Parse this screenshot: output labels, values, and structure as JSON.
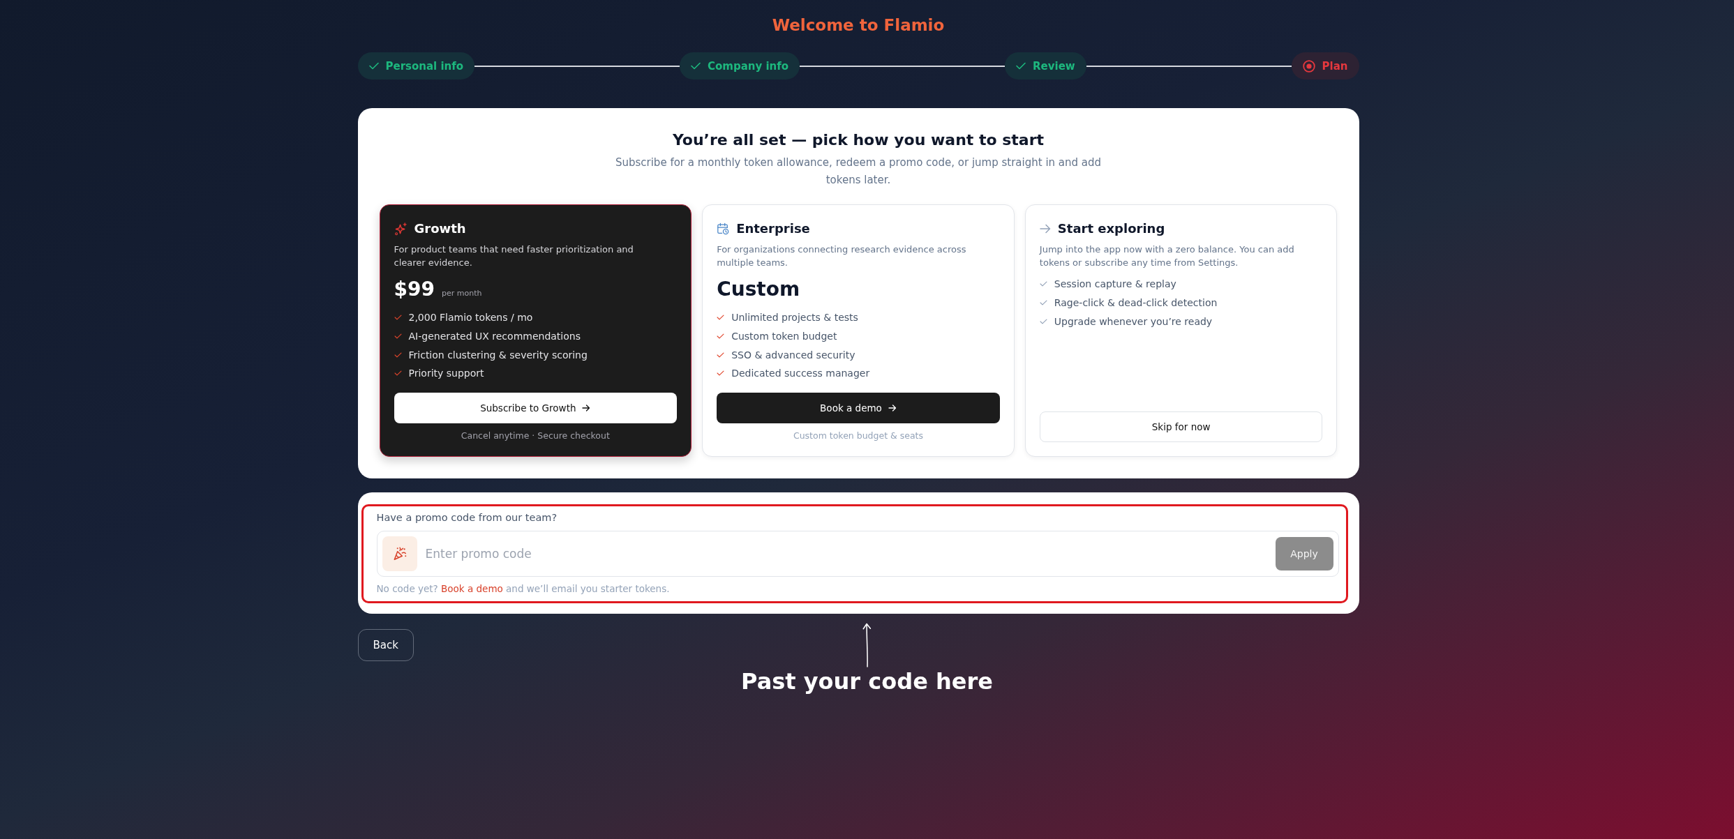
{
  "header": {
    "title": "Welcome to Flamio"
  },
  "steps": [
    {
      "label": "Personal info",
      "completed": true,
      "selected": false
    },
    {
      "label": "Company info",
      "completed": true,
      "selected": false
    },
    {
      "label": "Review",
      "completed": true,
      "selected": false
    },
    {
      "label": "Plan",
      "completed": false,
      "selected": true
    }
  ],
  "plan_picker": {
    "title": "You’re all set — pick how you want to start",
    "subtitle": "Subscribe for a monthly token allowance, redeem a promo code, or jump straight in and add tokens later.",
    "plans": [
      {
        "kind": "paid",
        "selected": true,
        "name": "Growth",
        "description": "For product teams that need faster prioritization and clearer evidence.",
        "price": "$99",
        "price_note": "per month",
        "features": [
          "2,000 Flamio tokens / mo",
          "AI-generated UX recommendations",
          "Friction clustering & severity scoring",
          "Priority support"
        ],
        "button": "Subscribe to Growth",
        "footnote": "Cancel anytime · Secure checkout"
      },
      {
        "kind": "custom",
        "selected": false,
        "name": "Enterprise",
        "description": "For organizations connecting research evidence across multiple teams.",
        "price": "Custom",
        "features": [
          "Unlimited projects & tests",
          "Custom token budget",
          "SSO & advanced security",
          "Dedicated success manager"
        ],
        "button": "Book a demo",
        "footnote": "Custom token budget & seats"
      },
      {
        "kind": "free",
        "selected": false,
        "name": "Start exploring",
        "description": "Jump into the app now with a zero balance. You can add tokens or subscribe any time from Settings.",
        "features": [
          "Session capture & replay",
          "Rage-click & dead-click detection",
          "Upgrade whenever you’re ready"
        ],
        "button": "Skip for now"
      }
    ]
  },
  "promo": {
    "highlighted": true,
    "label": "Have a promo code from our team?",
    "placeholder": "Enter promo code",
    "apply_button": {
      "label": "Apply",
      "disabled": true
    },
    "help": {
      "before": "No code yet?",
      "link": "Book a demo",
      "after": "and we’ll email you starter tokens."
    }
  },
  "back_button": "Back",
  "annotation": {
    "text": "Past your code here"
  }
}
